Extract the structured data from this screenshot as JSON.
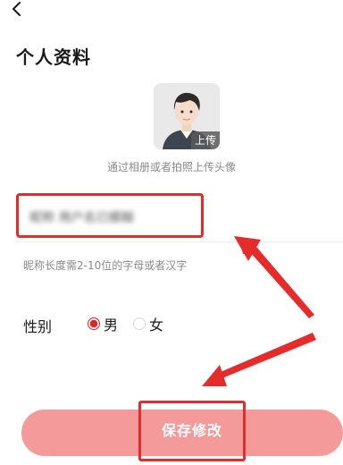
{
  "header": {
    "title": "个人资料",
    "back_icon": "chevron-left-icon"
  },
  "avatar": {
    "upload_label": "上传",
    "hint": "通过相册或者拍照上传头像",
    "icon": "avatar-icon"
  },
  "nickname": {
    "value": "昵称 用户名已模糊",
    "hint": "昵称长度需2-10位的字母或者汉字"
  },
  "gender": {
    "label": "性别",
    "options": [
      "男",
      "女"
    ],
    "selected": "男"
  },
  "save_button": {
    "label": "保存修改"
  },
  "colors": {
    "accent": "#e02525",
    "button": "#f49a9a",
    "highlight": "#e62b2b"
  }
}
